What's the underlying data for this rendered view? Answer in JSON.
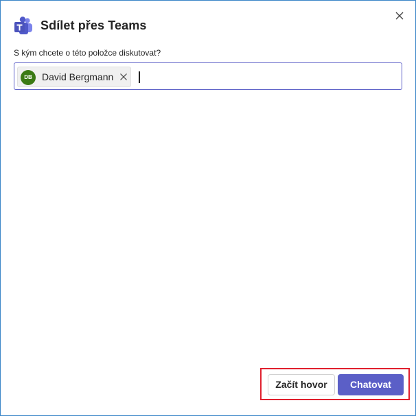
{
  "dialog": {
    "title": "Sdílet přes Teams",
    "logo_icon": "microsoft-teams-logo",
    "close_icon": "close-icon"
  },
  "recipients": {
    "label": "S kým chcete o této položce diskutovat?",
    "chips": [
      {
        "initials": "DB",
        "name": "David Bergmann",
        "avatar_color": "#3b7a14",
        "remove_icon": "close-icon"
      }
    ],
    "input_value": ""
  },
  "actions": {
    "call_label": "Začít hovor",
    "chat_label": "Chatovat"
  },
  "colors": {
    "accent": "#5b5fc7",
    "highlight": "#e0202e",
    "window_border": "#3a86c8"
  }
}
